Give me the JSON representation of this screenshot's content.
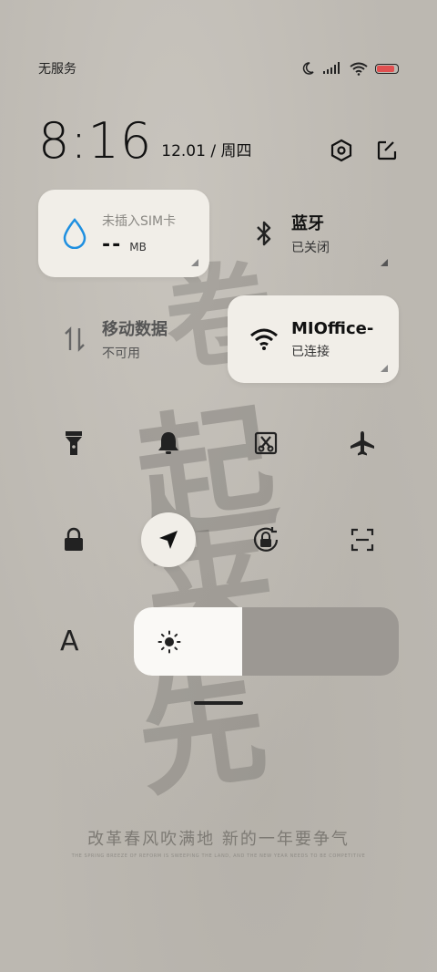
{
  "status": {
    "carrier": "无服务",
    "battery_level": 0.85,
    "battery_color": "#e05050"
  },
  "header": {
    "time": "8:16",
    "date": "12.01 / 周四",
    "settings_icon": "settings-hexagon-icon",
    "edit_icon": "edit-icon"
  },
  "tiles": {
    "data_usage": {
      "title": "未插入SIM卡",
      "value": "--",
      "unit": "MB",
      "icon": "water-drop-icon"
    },
    "bluetooth": {
      "title": "蓝牙",
      "status": "已关闭",
      "icon": "bluetooth-icon"
    },
    "mobile_data": {
      "title": "移动数据",
      "status": "不可用",
      "icon": "mobile-data-icon"
    },
    "wifi": {
      "title": "MIOffice-",
      "status": "已连接",
      "icon": "wifi-icon"
    }
  },
  "toggles": [
    {
      "name": "flashlight-icon"
    },
    {
      "name": "bell-icon"
    },
    {
      "name": "screenshot-icon"
    },
    {
      "name": "airplane-icon"
    },
    {
      "name": "lock-icon"
    },
    {
      "name": "location-icon"
    },
    {
      "name": "rotation-lock-icon"
    },
    {
      "name": "scan-icon"
    }
  ],
  "brightness": {
    "level": 0.41,
    "icon": "sun-icon"
  },
  "font_button": {
    "label": "A"
  },
  "wallpaper": {
    "slogan": "改革春风吹满地 新的一年要争气",
    "slogan_en": "THE SPRING BREEZE OF REFORM IS SWEEPING THE LAND, AND THE NEW YEAR NEEDS TO BE COMPETITIVE"
  }
}
